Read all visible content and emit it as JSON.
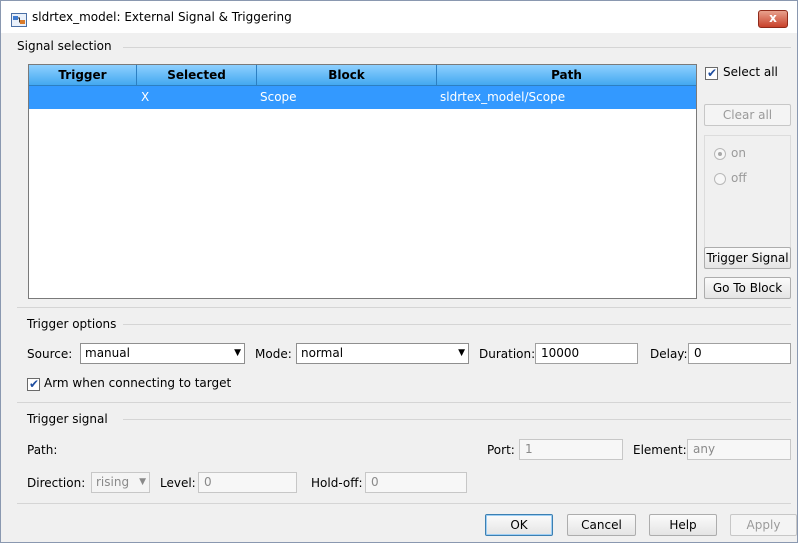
{
  "window": {
    "title": "sldrtex_model: External Signal & Triggering",
    "close_label": "x"
  },
  "signal_selection": {
    "label": "Signal selection",
    "columns": [
      "Trigger",
      "Selected",
      "Block",
      "Path"
    ],
    "rows": [
      {
        "trigger": "",
        "selected": "X",
        "block": "Scope",
        "path": "sldrtex_model/Scope"
      }
    ],
    "select_all_label": "Select all",
    "select_all_checked": true,
    "clear_all_label": "Clear all",
    "on_label": "on",
    "off_label": "off",
    "trigger_signal_label": "Trigger Signal",
    "goto_block_label": "Go To Block"
  },
  "trigger_options": {
    "label": "Trigger options",
    "source_label": "Source:",
    "source_value": "manual",
    "mode_label": "Mode:",
    "mode_value": "normal",
    "duration_label": "Duration:",
    "duration_value": "10000",
    "delay_label": "Delay:",
    "delay_value": "0",
    "arm_label": "Arm when connecting to target",
    "arm_checked": true
  },
  "trigger_signal": {
    "label": "Trigger signal",
    "path_label": "Path:",
    "port_label": "Port:",
    "port_value": "1",
    "element_label": "Element:",
    "element_value": "any",
    "direction_label": "Direction:",
    "direction_value": "rising",
    "level_label": "Level:",
    "level_value": "0",
    "holdoff_label": "Hold-off:",
    "holdoff_value": "0"
  },
  "buttons": {
    "ok": "OK",
    "cancel": "Cancel",
    "help": "Help",
    "apply": "Apply"
  }
}
